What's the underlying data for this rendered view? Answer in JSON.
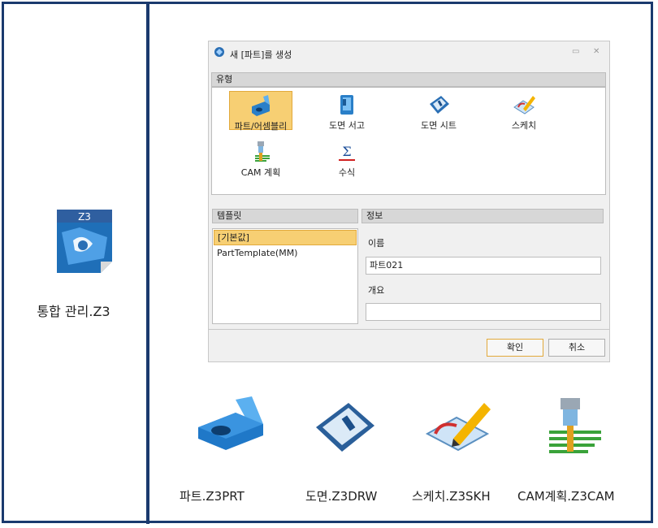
{
  "left_panel": {
    "app_label": "통합 관리.Z3",
    "app_icon": "z3-manager-icon"
  },
  "dialog": {
    "title": "새 [파트]를 생성",
    "title_icon": "z3-logo-icon",
    "buttons_titlebar": [
      "pin-icon",
      "close-icon"
    ],
    "type_section": "유형",
    "types": [
      {
        "label": "파트/어셈블리",
        "icon": "part-assembly-icon",
        "selected": true
      },
      {
        "label": "도면 서고",
        "icon": "drawing-library-icon",
        "selected": false
      },
      {
        "label": "도면 시트",
        "icon": "drawing-sheet-icon",
        "selected": false
      },
      {
        "label": "스케치",
        "icon": "sketch-icon",
        "selected": false
      },
      {
        "label": "CAM 계획",
        "icon": "cam-plan-icon",
        "selected": false
      },
      {
        "label": "수식",
        "icon": "equation-icon",
        "selected": false
      }
    ],
    "template_section": "템플릿",
    "templates": [
      "[기본값]",
      "PartTemplate(MM)"
    ],
    "info_section": "정보",
    "name_label": "이름",
    "name_value": "파트021",
    "desc_label": "개요",
    "desc_value": "",
    "ok_label": "확인",
    "cancel_label": "취소"
  },
  "file_types": [
    {
      "label": "파트.Z3PRT",
      "icon": "part-file-icon"
    },
    {
      "label": "도면.Z3DRW",
      "icon": "drawing-file-icon"
    },
    {
      "label": "스케치.Z3SKH",
      "icon": "sketch-file-icon"
    },
    {
      "label": "CAM계획.Z3CAM",
      "icon": "cam-file-icon"
    }
  ]
}
